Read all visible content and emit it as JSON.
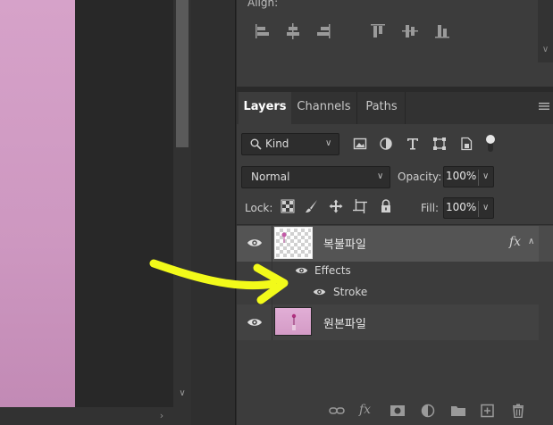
{
  "props_panel": {
    "align_label": "Align:"
  },
  "tabs": [
    {
      "label": "Layers"
    },
    {
      "label": "Channels"
    },
    {
      "label": "Paths"
    }
  ],
  "filter": {
    "kind_label": "Kind"
  },
  "blend": {
    "mode": "Normal",
    "opacity_label": "Opacity:",
    "opacity_value": "100%"
  },
  "lock": {
    "label": "Lock:",
    "fill_label": "Fill:",
    "fill_value": "100%"
  },
  "layers": [
    {
      "name": "복불파일",
      "fx": "fx",
      "effects_label": "Effects",
      "stroke_label": "Stroke"
    },
    {
      "name": "원본파일"
    }
  ],
  "colors": {
    "arrow": "#f2fa1a",
    "canvas_pink": "#d6a2c9",
    "panel_bg": "#3c3c3c",
    "selected_row": "#545454"
  }
}
